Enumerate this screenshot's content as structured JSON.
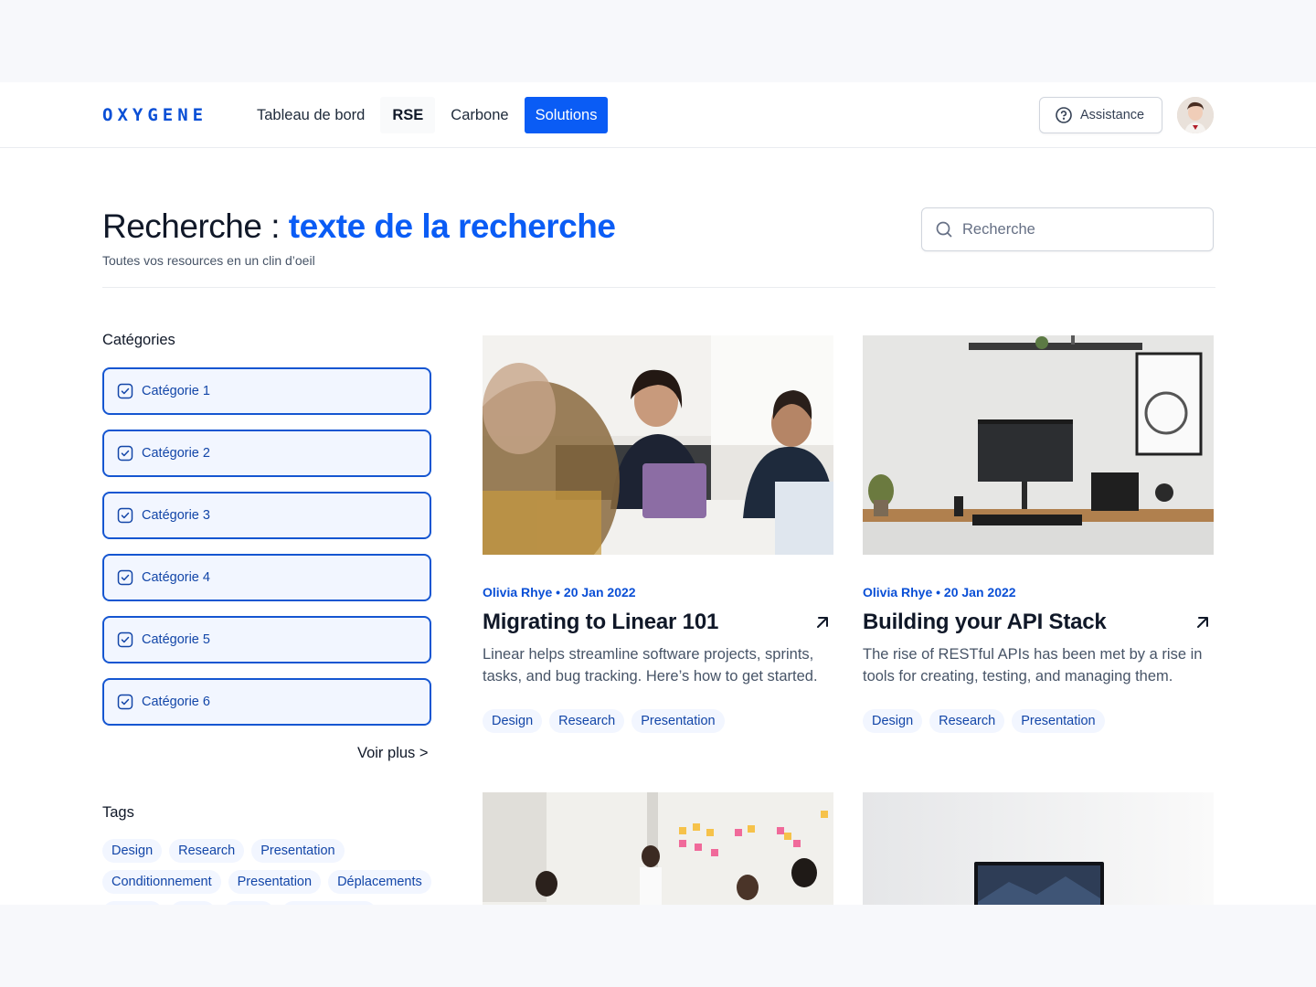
{
  "header": {
    "logo": "OXYGENE",
    "nav": [
      {
        "label": "Tableau de bord",
        "state": "default"
      },
      {
        "label": "RSE",
        "state": "hover"
      },
      {
        "label": "Carbone",
        "state": "default"
      },
      {
        "label": "Solutions",
        "state": "active"
      }
    ],
    "help_label": "Assistance"
  },
  "page": {
    "title_prefix": "Recherche : ",
    "title_query": "texte de la recherche",
    "subtitle": "Toutes vos resources en un clin d’oeil",
    "search_placeholder": "Recherche"
  },
  "sidebar": {
    "categories_heading": "Catégories",
    "categories": [
      "Catégorie 1",
      "Catégorie 2",
      "Catégorie 3",
      "Catégorie 4",
      "Catégorie 5",
      "Catégorie 6"
    ],
    "see_more": "Voir plus >",
    "tags_heading": "Tags",
    "tags": [
      "Design",
      "Research",
      "Presentation",
      "Conditionnement",
      "Presentation",
      "Déplacements"
    ]
  },
  "cards": [
    {
      "meta": "Olivia Rhye • 20 Jan 2022",
      "title": "Migrating to Linear 101",
      "desc": "Linear helps streamline software projects, sprints, tasks, and bug tracking. Here’s how to get started.",
      "tags": [
        "Design",
        "Research",
        "Presentation"
      ]
    },
    {
      "meta": "Olivia Rhye • 20 Jan 2022",
      "title": "Building your API Stack",
      "desc": "The rise of RESTful APIs has been met by a rise in tools for creating, testing, and managing them.",
      "tags": [
        "Design",
        "Research",
        "Presentation"
      ]
    }
  ],
  "colors": {
    "brand": "#0a5cf5",
    "category_border": "#1556d1",
    "tag_bg": "#f2f6ff"
  }
}
